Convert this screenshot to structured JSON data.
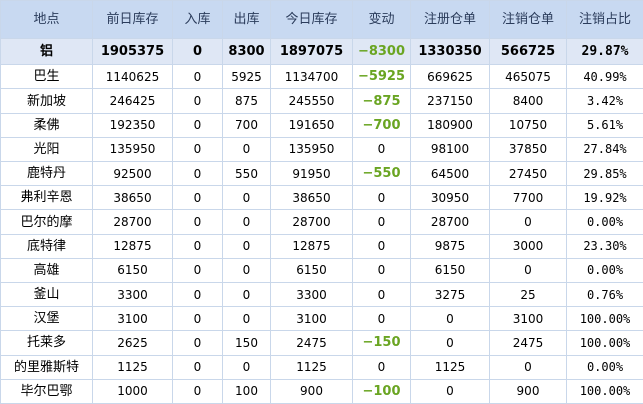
{
  "columns": [
    "地点",
    "前日库存",
    "入库",
    "出库",
    "今日库存",
    "变动",
    "注册仓单",
    "注销仓单",
    "注销占比"
  ],
  "total": [
    "铝",
    "1905375",
    "0",
    "8300",
    "1897075",
    "−8300",
    "1330350",
    "566725",
    "29.87%"
  ],
  "rows": [
    [
      "巴生",
      "1140625",
      "0",
      "5925",
      "1134700",
      "−5925",
      "669625",
      "465075",
      "40.99%"
    ],
    [
      "新加坡",
      "246425",
      "0",
      "875",
      "245550",
      "−875",
      "237150",
      "8400",
      "3.42%"
    ],
    [
      "柔佛",
      "192350",
      "0",
      "700",
      "191650",
      "−700",
      "180900",
      "10750",
      "5.61%"
    ],
    [
      "光阳",
      "135950",
      "0",
      "0",
      "135950",
      "0",
      "98100",
      "37850",
      "27.84%"
    ],
    [
      "鹿特丹",
      "92500",
      "0",
      "550",
      "91950",
      "−550",
      "64500",
      "27450",
      "29.85%"
    ],
    [
      "弗利辛恩",
      "38650",
      "0",
      "0",
      "38650",
      "0",
      "30950",
      "7700",
      "19.92%"
    ],
    [
      "巴尔的摩",
      "28700",
      "0",
      "0",
      "28700",
      "0",
      "28700",
      "0",
      "0.00%"
    ],
    [
      "底特律",
      "12875",
      "0",
      "0",
      "12875",
      "0",
      "9875",
      "3000",
      "23.30%"
    ],
    [
      "高雄",
      "6150",
      "0",
      "0",
      "6150",
      "0",
      "6150",
      "0",
      "0.00%"
    ],
    [
      "釜山",
      "3300",
      "0",
      "0",
      "3300",
      "0",
      "3275",
      "25",
      "0.76%"
    ],
    [
      "汉堡",
      "3100",
      "0",
      "0",
      "3100",
      "0",
      "0",
      "3100",
      "100.00%"
    ],
    [
      "托莱多",
      "2625",
      "0",
      "150",
      "2475",
      "−150",
      "0",
      "2475",
      "100.00%"
    ],
    [
      "的里雅斯特",
      "1125",
      "0",
      "0",
      "1125",
      "0",
      "1125",
      "0",
      "0.00%"
    ],
    [
      "毕尔巴鄂",
      "1000",
      "0",
      "100",
      "900",
      "−100",
      "0",
      "900",
      "100.00%"
    ]
  ],
  "colors": {
    "header_bg": "#c8d9f1",
    "total_bg": "#dfe7f5",
    "negative": "#6aa522",
    "border": "#c9d7ea"
  }
}
